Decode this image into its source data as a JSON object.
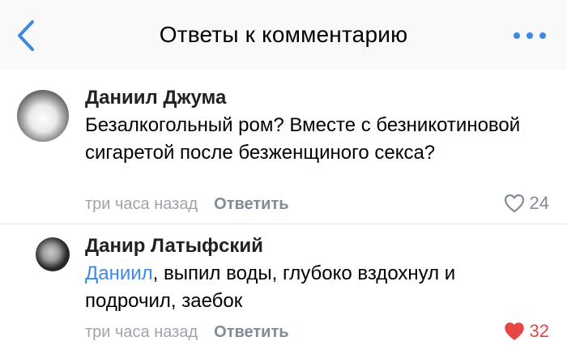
{
  "header": {
    "title": "Ответы к комментарию"
  },
  "comments": [
    {
      "author": "Даниил Джума",
      "text": "Безалкогольный ром? Вместе с безникотиновой сигаретой после безженщиного секса?",
      "time": "три часа назад",
      "reply_label": "Ответить",
      "likes": "24",
      "liked": false
    },
    {
      "author": "Данир Латыфский",
      "mention": "Даниил",
      "text": ", выпил воды, глубоко вздохнул и подрочил, заебок",
      "time": "три часа назад",
      "reply_label": "Ответить",
      "likes": "32",
      "liked": true
    }
  ],
  "colors": {
    "accent": "#3f8ae0",
    "liked": "#e64646",
    "secondary": "#818c99"
  }
}
